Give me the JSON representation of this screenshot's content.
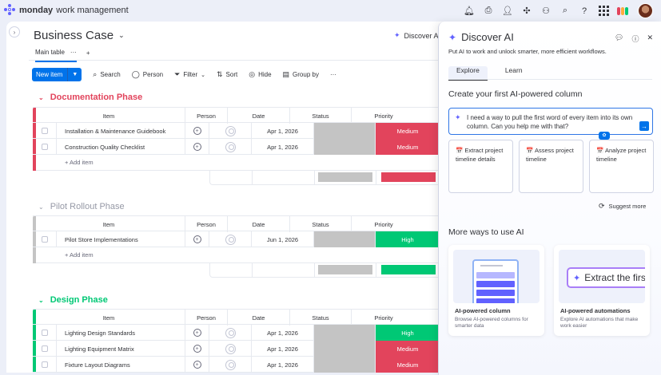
{
  "app": {
    "brand": "monday",
    "product": "work management"
  },
  "board": {
    "title": "Business Case",
    "discover_label": "Discover AI",
    "main_tab": "Main table",
    "add_tab": "+"
  },
  "toolbar": {
    "new_item": "New item",
    "search": "Search",
    "person": "Person",
    "filter": "Filter",
    "sort": "Sort",
    "hide": "Hide",
    "group_by": "Group by",
    "more": "···"
  },
  "columns": {
    "item": "Item",
    "person": "Person",
    "date": "Date",
    "status": "Status",
    "priority": "Priority"
  },
  "add_item": "+ Add item",
  "groups": [
    {
      "title": "Documentation Phase",
      "color": "#e2445c",
      "rows": [
        {
          "item": "Installation & Maintenance Guidebook",
          "date": "Apr 1, 2026",
          "priority": "Medium",
          "priority_color": "#e2445c"
        },
        {
          "item": "Construction Quality Checklist",
          "date": "Apr 1, 2026",
          "priority": "Medium",
          "priority_color": "#e2445c"
        }
      ]
    },
    {
      "title": "Pilot Rollout Phase",
      "color": "#c4c4c4",
      "rows": [
        {
          "item": "Pilot Store Implementations",
          "date": "Jun 1, 2026",
          "priority": "High",
          "priority_color": "#00c875"
        }
      ]
    },
    {
      "title": "Design Phase",
      "color": "#00c875",
      "rows": [
        {
          "item": "Lighting Design Standards",
          "date": "Apr 1, 2026",
          "priority": "High",
          "priority_color": "#00c875"
        },
        {
          "item": "Lighting Equipment Matrix",
          "date": "Apr 1, 2026",
          "priority": "Medium",
          "priority_color": "#e2445c"
        },
        {
          "item": "Fixture Layout Diagrams",
          "date": "Apr 1, 2026",
          "priority": "Medium",
          "priority_color": "#e2445c"
        }
      ]
    }
  ],
  "panel": {
    "title": "Discover AI",
    "subtitle": "Put AI to work and unlock smarter, more efficient workflows.",
    "tabs": [
      "Explore",
      "Learn"
    ],
    "heading": "Create your first AI-powered column",
    "prompt_text": "I need a way to pull the first word of every item into its own column. Can you help me with that?",
    "suggestions": [
      "📅 Extract project timeline details",
      "📅 Assess project timeline",
      "📅 Analyze project timeline"
    ],
    "suggest_more": "Suggest more",
    "more_heading": "More ways to use AI",
    "extract_preview": "Extract the first",
    "use_cards": [
      {
        "title": "AI-powered column",
        "desc": "Browse AI-powered columns for smarter data"
      },
      {
        "title": "AI-powered automations",
        "desc": "Explore AI automations that make work easier"
      }
    ]
  },
  "colors": {
    "accent": "#0073ea",
    "status_empty": "#c4c4c4",
    "ai_purple": "#6161ff"
  }
}
